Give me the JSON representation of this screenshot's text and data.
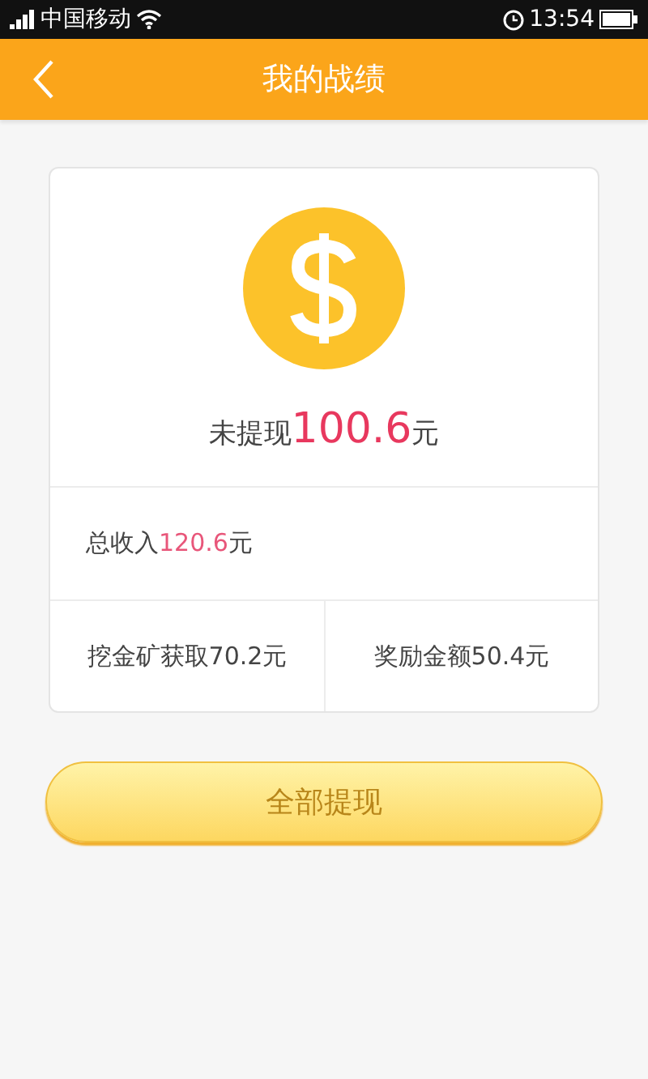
{
  "status_bar": {
    "carrier": "中国移动",
    "time": "13:54"
  },
  "header": {
    "title": "我的战绩"
  },
  "summary": {
    "pending": {
      "label": "未提现",
      "amount": "100.6",
      "unit": "元"
    },
    "total": {
      "label": "总收入",
      "amount": "120.6",
      "unit": "元"
    },
    "breakdown": [
      "挖金矿获取70.2元",
      "奖励金额50.4元"
    ]
  },
  "withdraw_button": "全部提现"
}
